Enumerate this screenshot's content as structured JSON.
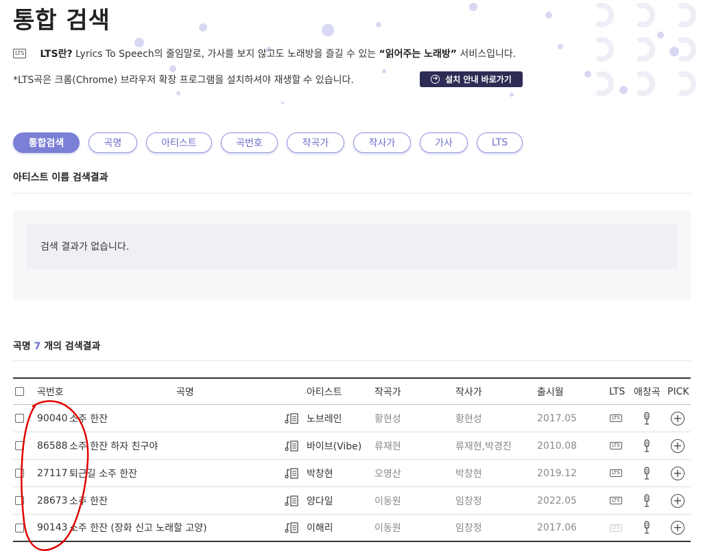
{
  "page": {
    "title": "통합 검색"
  },
  "lts_info": {
    "badge": "LTS",
    "question": "LTS란?",
    "text_1": " Lyrics To Speech의 줄임말로, 가사를 보지 않고도 노래방을 즐길 수 있는 ",
    "highlight": "“읽어주는 노래방”",
    "text_2": " 서비스입니다.",
    "chrome_note": "*LTS곡은 크롬(Chrome) 브라우저 확장 프로그램을 설치하셔야 재생할 수 있습니다.",
    "install_button": "설치 안내 바로가기"
  },
  "tabs": [
    {
      "label": "통합검색",
      "active": true
    },
    {
      "label": "곡명",
      "active": false
    },
    {
      "label": "아티스트",
      "active": false
    },
    {
      "label": "곡번호",
      "active": false
    },
    {
      "label": "작곡가",
      "active": false
    },
    {
      "label": "작사가",
      "active": false
    },
    {
      "label": "가사",
      "active": false
    },
    {
      "label": "LTS",
      "active": false
    }
  ],
  "artist_section": {
    "title": "아티스트 이름 검색결과",
    "empty_message": "검색 결과가 없습니다."
  },
  "song_section": {
    "title_prefix": "곡명",
    "count": "7",
    "title_suffix": "개의 검색결과"
  },
  "table": {
    "headers": {
      "number": "곡번호",
      "title": "곡명",
      "artist": "아티스트",
      "composer": "작곡가",
      "lyricist": "작사가",
      "release": "출시월",
      "lts": "LTS",
      "favorite": "애창곡",
      "pick": "PICK"
    },
    "rows": [
      {
        "number": "90040",
        "title": "소주 한잔",
        "artist": "노브레인",
        "composer": "황현성",
        "lyricist": "황현성",
        "release": "2017.05",
        "lts": "LTS"
      },
      {
        "number": "86588",
        "title": "소주 한잔 하자 친구야",
        "artist": "바이브(Vibe)",
        "composer": "류재현",
        "lyricist": "류재현,박경진",
        "release": "2010.08",
        "lts": "LTS"
      },
      {
        "number": "27117",
        "title": "퇴근길 소주 한잔",
        "artist": "박창현",
        "composer": "오영산",
        "lyricist": "박창현",
        "release": "2019.12",
        "lts": "LTS"
      },
      {
        "number": "28673",
        "title": "소주 한잔",
        "artist": "양다일",
        "composer": "이동원",
        "lyricist": "임창정",
        "release": "2022.05",
        "lts": "LTS"
      },
      {
        "number": "90143",
        "title": "소주 한잔 (장화 신고 노래할 고양)",
        "artist": "이해리",
        "composer": "이동원",
        "lyricist": "임창정",
        "release": "2017.06",
        "lts": "LTS"
      }
    ]
  },
  "colors": {
    "accent": "#7b80d6",
    "button_dark": "#2c2c54",
    "annotation": "#e00000"
  }
}
